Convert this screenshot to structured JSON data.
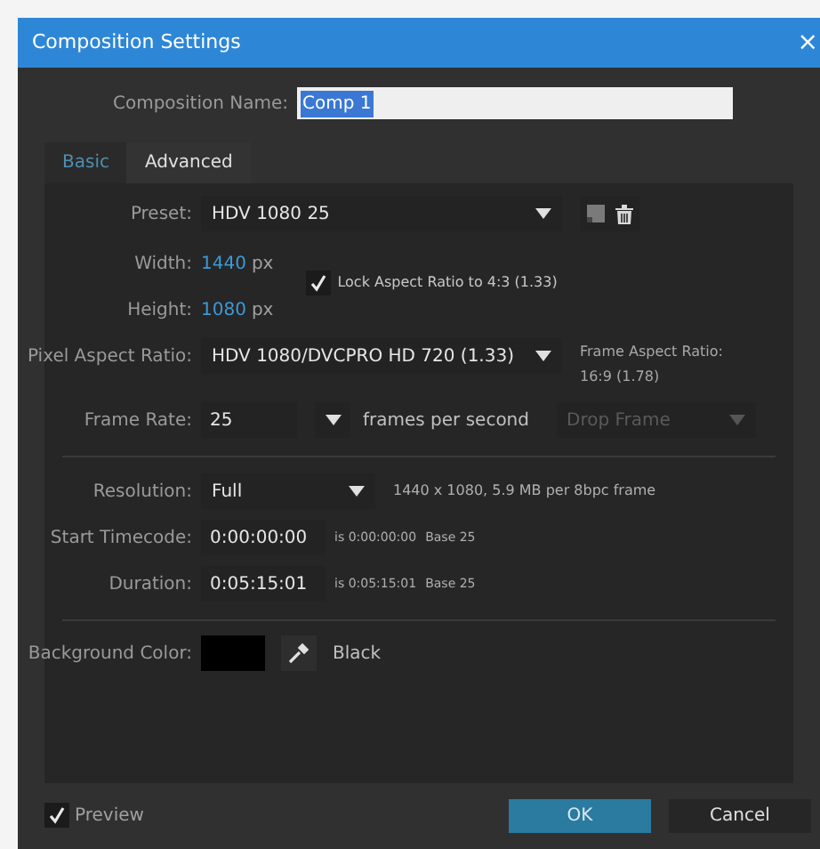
{
  "window": {
    "title": "Composition Settings",
    "close": "×"
  },
  "composition_name": {
    "label": "Composition Name:",
    "value": "Comp 1",
    "text_selected": true
  },
  "tabs": [
    {
      "label": "Basic",
      "selected": true
    },
    {
      "label": "Advanced",
      "selected": false
    }
  ],
  "preset": {
    "label": "Preset:",
    "value": "HDV 1080 25"
  },
  "width": {
    "label": "Width:",
    "value": "1440",
    "unit": "px"
  },
  "height": {
    "label": "Height:",
    "value": "1080",
    "unit": "px"
  },
  "lock_aspect": {
    "label": "Lock Aspect Ratio to 4:3 (1.33)",
    "checked": true
  },
  "pixel_aspect_ratio": {
    "label": "Pixel Aspect Ratio:",
    "value": "HDV 1080/DVCPRO HD 720 (1.33)"
  },
  "frame_aspect_ratio": {
    "label": "Frame Aspect Ratio:",
    "value": "16:9 (1.78)"
  },
  "frame_rate": {
    "label": "Frame Rate:",
    "value": "25",
    "unit": "frames per second",
    "drop_frame": {
      "value": "Drop Frame",
      "disabled": true
    }
  },
  "resolution": {
    "label": "Resolution:",
    "value": "Full",
    "info": "1440 x 1080, 5.9 MB per 8bpc frame"
  },
  "timecodes": [
    {
      "label": "Start Timecode:",
      "value": "0:00:00:00",
      "info": "is 0:00:00:00",
      "base": "Base 25"
    },
    {
      "label": "Duration:",
      "value": "0:05:15:01",
      "info": "is 0:05:15:01",
      "base": "Base 25"
    }
  ],
  "background_color": {
    "label": "Background Color:",
    "color": "#000000",
    "name": "Black"
  },
  "preview": {
    "label": "Preview",
    "checked": true
  },
  "buttons": [
    {
      "label": "OK",
      "kind": "primary"
    },
    {
      "label": "Cancel",
      "kind": "secondary"
    }
  ]
}
